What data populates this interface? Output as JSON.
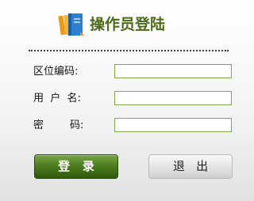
{
  "header": {
    "title": "操作员登陆",
    "logo_icon": "book-stack-icon",
    "accent_color": "#4c6b18"
  },
  "form": {
    "region_code_label": "区位编码:",
    "username_label": "用  户  名:",
    "password_label": "密        码:",
    "region_code_value": "",
    "username_value": "",
    "password_value": ""
  },
  "buttons": {
    "login_label": "登   录",
    "exit_label": "退   出"
  }
}
